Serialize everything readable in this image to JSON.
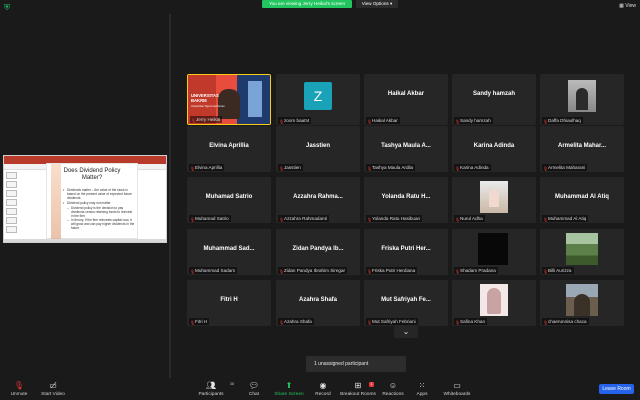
{
  "topbar": {
    "banner": "You are viewing Jerry Heikal's screen",
    "view_options": "View Options",
    "view_btn": "View",
    "view_options_caret": "▾"
  },
  "slide": {
    "title": "Does Dividend Policy Matter?",
    "bullets": [
      "Dividends matter – the value of the stock is based on the present value of expected future dividends",
      "Dividend policy may not matter"
    ],
    "sub_bullets": [
      "Dividend policy is the decision to pay dividends versus retaining funds to reinvest in the firm",
      "In theory, if the firm reinvests capital now, it will grow and can pay higher dividends in the future"
    ]
  },
  "tiles": [
    {
      "name": "",
      "caption": "Jerry Heikal",
      "type": "video-presenter",
      "active": true
    },
    {
      "name": "",
      "caption": "zoom baa04",
      "type": "avatar",
      "avatar": "Z"
    },
    {
      "name": "Haikal Akbar",
      "caption": "Haikal Akbar",
      "type": "name"
    },
    {
      "name": "Sandy hamzah",
      "caption": "Sandy hamzah",
      "type": "name"
    },
    {
      "name": "",
      "caption": "Daffa Dhiaulhaq",
      "type": "photo-man"
    },
    {
      "name": "Elvina Aprillia",
      "caption": "Elvina Aprillia",
      "type": "name"
    },
    {
      "name": "Jasstien",
      "caption": "Jasstien",
      "type": "name"
    },
    {
      "name": "Tashya Maula A...",
      "caption": "Tashya Maula Ardila",
      "type": "name"
    },
    {
      "name": "Karina Adinda",
      "caption": "Karina Adinda",
      "type": "name"
    },
    {
      "name": "Armelita Mahar...",
      "caption": "Armelita Maharani",
      "type": "name"
    },
    {
      "name": "Muhamad Satrio",
      "caption": "Muhamad Satrio",
      "type": "name"
    },
    {
      "name": "Azzahra Rahma...",
      "caption": "Azzahra Rahmadanti",
      "type": "name"
    },
    {
      "name": "Yolanda Ratu H...",
      "caption": "Yolanda Ratu Hasibuan",
      "type": "name"
    },
    {
      "name": "",
      "caption": "Nurul Adha",
      "type": "photo-girl"
    },
    {
      "name": "Muhammad Al Atiq",
      "caption": "Muhammad Al Atiq",
      "type": "name"
    },
    {
      "name": "Muhammad Sad...",
      "caption": "Muhammad Sadam",
      "type": "name"
    },
    {
      "name": "Zidan Pandya Ib...",
      "caption": "Zidan Pandya Ibrahim Siregar",
      "type": "name"
    },
    {
      "name": "Friska Putri Her...",
      "caption": "Friska Putri Herdiana",
      "type": "name"
    },
    {
      "name": "",
      "caption": "Shadam Pradana",
      "type": "dark-photo"
    },
    {
      "name": "",
      "caption": "Billi Aurizza",
      "type": "landscape"
    },
    {
      "name": "Fitri H",
      "caption": "Fitri H",
      "type": "name"
    },
    {
      "name": "Azahra Shafa",
      "caption": "Azahra Shafa",
      "type": "name"
    },
    {
      "name": "Mut Safriyah Fe...",
      "caption": "Mut Safriyah Febriani",
      "type": "name"
    },
    {
      "name": "",
      "caption": "Safina Khan",
      "type": "photo-woman"
    },
    {
      "name": "",
      "caption": "chaerunnisa chaca",
      "type": "building"
    }
  ],
  "presenter_slide": {
    "line1": "UNIVERSITAS",
    "line2": "BAKRIE",
    "line3": "Universitas Tiga Lima Persen"
  },
  "pagination_down": "⌄",
  "unassigned": "1 unassigned participant",
  "toolbar": {
    "unmute": "Unmute",
    "start_video": "Start Video",
    "participants": "Participants",
    "participants_count": "38",
    "chat": "Chat",
    "share_screen": "Share Screen",
    "record": "Record",
    "breakout": "Breakout Rooms",
    "breakout_badge": "1",
    "reactions": "Reactions",
    "apps": "Apps",
    "whiteboards": "Whiteboards",
    "leave": "Leave Room"
  },
  "colors": {
    "banner_green": "#22c55e",
    "active_border": "#facc15",
    "leave_blue": "#2563eb",
    "muted_red": "#e53935",
    "avatar_teal": "#1aa3b8"
  }
}
